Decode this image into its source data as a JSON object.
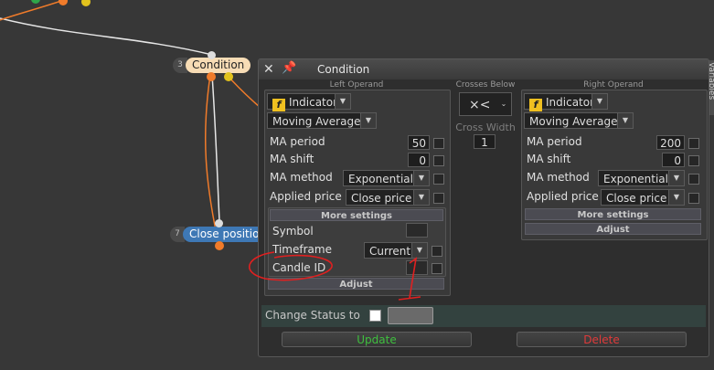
{
  "canvas": {
    "condition_node": {
      "number": "3",
      "label": "Condition"
    },
    "close_node": {
      "number": "7",
      "label": "Close position"
    },
    "side_tab": "Variables"
  },
  "window": {
    "title": "Condition",
    "close_glyph": "✕",
    "pin_glyph": "📌"
  },
  "left": {
    "section": "Left Operand",
    "type": "Indicator",
    "indicator": "Moving Average",
    "params": [
      {
        "label": "MA period",
        "value": "50"
      },
      {
        "label": "MA shift",
        "value": "0"
      },
      {
        "label": "MA method",
        "value": "Exponential"
      },
      {
        "label": "Applied price",
        "value": "Close price"
      }
    ],
    "more_settings": "More settings",
    "symbol_label": "Symbol",
    "timeframe_label": "Timeframe",
    "timeframe_value": "Current",
    "candle_label": "Candle ID",
    "adjust": "Adjust"
  },
  "middle": {
    "section": "Crosses Below",
    "operator": "×<",
    "cross_width_label": "Cross Width",
    "cross_width_value": "1"
  },
  "right": {
    "section": "Right Operand",
    "type": "Indicator",
    "indicator": "Moving Average",
    "params": [
      {
        "label": "MA period",
        "value": "200"
      },
      {
        "label": "MA shift",
        "value": "0"
      },
      {
        "label": "MA method",
        "value": "Exponential"
      },
      {
        "label": "Applied price",
        "value": "Close price"
      }
    ],
    "more_settings": "More settings",
    "adjust": "Adjust"
  },
  "status": {
    "label": "Change Status to"
  },
  "buttons": {
    "update": "Update",
    "delete": "Delete"
  },
  "annotation": {
    "text": "1"
  },
  "colors": {
    "update": "#3fbf3f",
    "delete": "#e03a3a",
    "annotation": "#e02020",
    "wire": "#f07b2a"
  }
}
